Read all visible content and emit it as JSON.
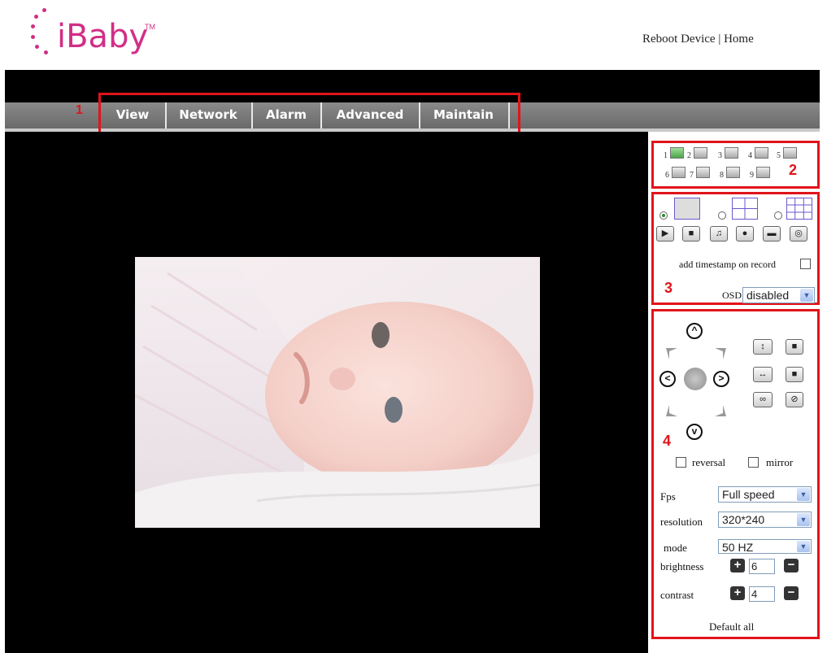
{
  "header": {
    "logo_text": "iBaby",
    "logo_tm": "TM",
    "links": {
      "reboot": "Reboot Device",
      "separator": "|",
      "home": "Home"
    }
  },
  "nav": {
    "marker": "1",
    "items": [
      "View",
      "Network",
      "Alarm",
      "Advanced",
      "Maintain"
    ]
  },
  "cameras": {
    "marker": "2",
    "labels": [
      "1",
      "2",
      "3",
      "4",
      "5",
      "6",
      "7",
      "8",
      "9"
    ]
  },
  "view_controls": {
    "marker": "3",
    "timestamp_label": "add timestamp on record",
    "osd_label": "OSD",
    "osd_value": "disabled"
  },
  "ptz": {
    "marker": "4",
    "reversal_label": "reversal",
    "mirror_label": "mirror"
  },
  "settings": {
    "fps_label": "Fps",
    "fps_value": "Full speed",
    "resolution_label": "resolution",
    "resolution_value": "320*240",
    "mode_label": "mode",
    "mode_value": "50 HZ",
    "brightness_label": "brightness",
    "brightness_value": "6",
    "contrast_label": "contrast",
    "contrast_value": "4",
    "default_label": "Default all"
  },
  "colors": {
    "brand": "#d12f86",
    "highlight": "#e0141a",
    "nav": "#777777"
  }
}
